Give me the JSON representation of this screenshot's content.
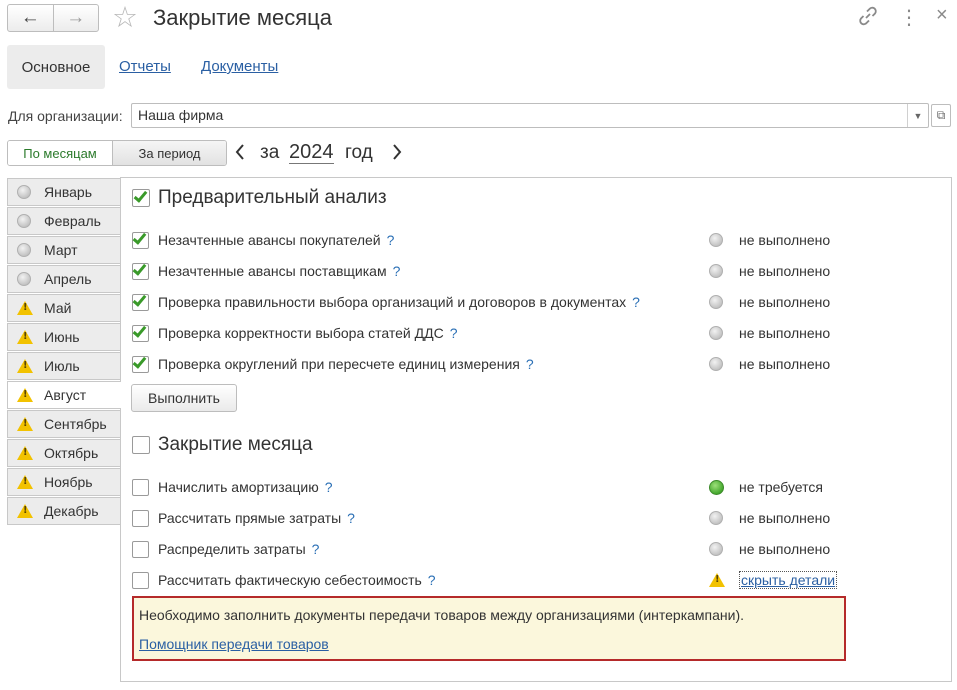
{
  "window": {
    "title": "Закрытие месяца",
    "back_icon": "←",
    "forward_icon": "→",
    "star_icon": "☆",
    "link_icon": "🔗",
    "more_icon": "⋮",
    "close_icon": "×"
  },
  "tabs": {
    "main": "Основное",
    "reports": "Отчеты",
    "documents": "Документы"
  },
  "organization": {
    "label": "Для организации:",
    "value": "Наша фирма",
    "drop_icon": "▼",
    "open_icon": "⧉"
  },
  "period": {
    "by_months": "По месяцам",
    "for_period": "За период",
    "prefix": "за",
    "year": "2024",
    "suffix": "год",
    "prev": "‹",
    "next": "›"
  },
  "months": [
    {
      "name": "Январь",
      "status": "grey"
    },
    {
      "name": "Февраль",
      "status": "grey"
    },
    {
      "name": "Март",
      "status": "grey"
    },
    {
      "name": "Апрель",
      "status": "grey"
    },
    {
      "name": "Май",
      "status": "warning"
    },
    {
      "name": "Июнь",
      "status": "warning"
    },
    {
      "name": "Июль",
      "status": "warning"
    },
    {
      "name": "Август",
      "status": "warning",
      "active": true
    },
    {
      "name": "Сентябрь",
      "status": "warning"
    },
    {
      "name": "Октябрь",
      "status": "warning"
    },
    {
      "name": "Ноябрь",
      "status": "warning"
    },
    {
      "name": "Декабрь",
      "status": "warning"
    }
  ],
  "analysis": {
    "title": "Предварительный анализ",
    "checked": true,
    "items": [
      {
        "label": "Незачтенные авансы покупателей",
        "help": "?",
        "status": "не выполнено",
        "checked": true
      },
      {
        "label": "Незачтенные авансы поставщикам",
        "help": "?",
        "status": "не выполнено",
        "checked": true
      },
      {
        "label": "Проверка правильности выбора организаций и договоров в документах",
        "help": "?",
        "status": "не выполнено",
        "checked": true
      },
      {
        "label": "Проверка корректности выбора статей ДДС",
        "help": "?",
        "status": "не выполнено",
        "checked": true
      },
      {
        "label": "Проверка округлений при пересчете единиц измерения",
        "help": "?",
        "status": "не выполнено",
        "checked": true
      }
    ],
    "run_button": "Выполнить"
  },
  "closing": {
    "title": "Закрытие месяца",
    "checked": false,
    "items": [
      {
        "label": "Начислить амортизацию",
        "help": "?",
        "status": "не требуется",
        "indicator": "green"
      },
      {
        "label": "Рассчитать прямые затраты",
        "help": "?",
        "status": "не выполнено",
        "indicator": "grey"
      },
      {
        "label": "Распределить затраты",
        "help": "?",
        "status": "не выполнено",
        "indicator": "grey"
      },
      {
        "label": "Рассчитать фактическую себестоимость",
        "help": "?",
        "status": "скрыть детали",
        "indicator": "warning"
      }
    ]
  },
  "notice": {
    "text": "Необходимо заполнить документы передачи товаров между организациями (интеркампани).",
    "link": "Помощник передачи товаров",
    "border_color": "#b52a2a",
    "background": "#fbf7dc"
  }
}
